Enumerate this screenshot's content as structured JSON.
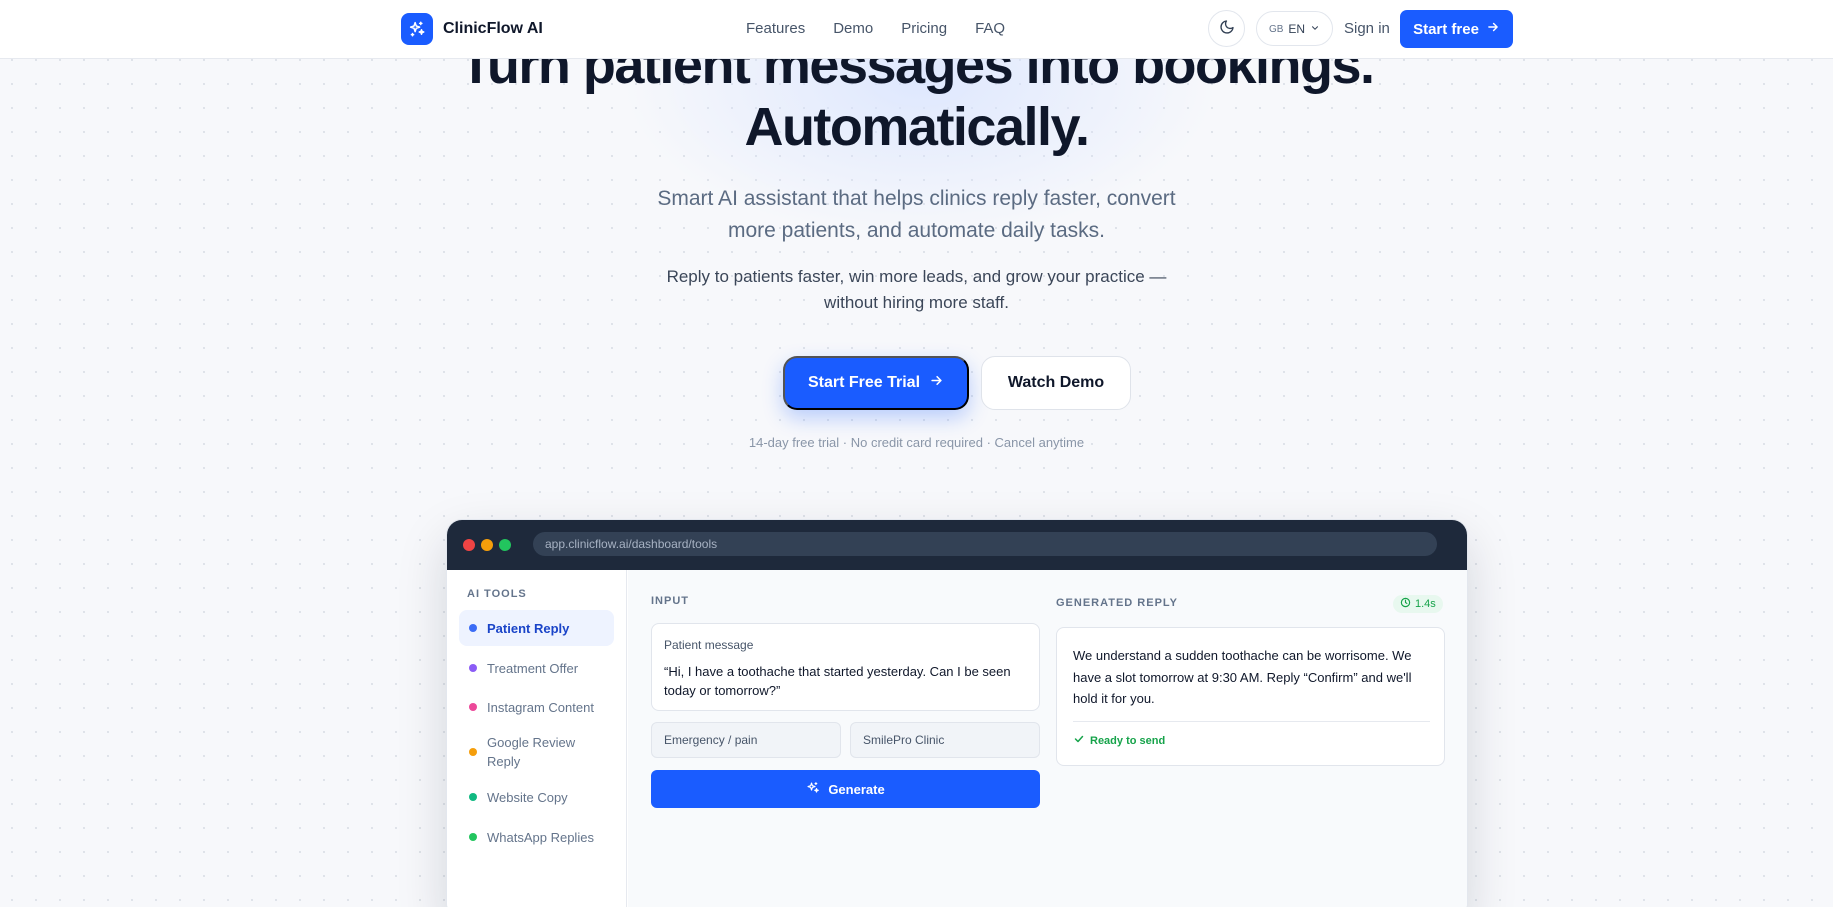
{
  "header": {
    "brand": "ClinicFlow AI",
    "nav": [
      "Features",
      "Demo",
      "Pricing",
      "FAQ"
    ],
    "lang_flag": "GB",
    "lang_code": "EN",
    "sign_in": "Sign in",
    "start_free": "Start free"
  },
  "hero": {
    "title_line1": "Turn patient messages into bookings.",
    "title_line2": "Automatically.",
    "subtitle": "Smart AI assistant that helps clinics reply faster, convert more patients, and automate daily tasks.",
    "subtitle2": "Reply to patients faster, win more leads, and grow your practice — without hiring more staff.",
    "cta_primary": "Start Free Trial",
    "cta_secondary": "Watch Demo",
    "fineprint": "14-day free trial · No credit card required · Cancel anytime"
  },
  "app": {
    "url": "app.clinicflow.ai/dashboard/tools",
    "sidebar_heading": "AI TOOLS",
    "tools": [
      {
        "label": "Patient Reply",
        "color": "#3b6cf6",
        "active": true
      },
      {
        "label": "Treatment Offer",
        "color": "#8b5cf6",
        "active": false
      },
      {
        "label": "Instagram Content",
        "color": "#ec4899",
        "active": false
      },
      {
        "label": "Google Review Reply",
        "color": "#f59e0b",
        "active": false
      },
      {
        "label": "Website Copy",
        "color": "#10b981",
        "active": false
      },
      {
        "label": "WhatsApp Replies",
        "color": "#22c55e",
        "active": false
      }
    ],
    "input_label": "INPUT",
    "message_label": "Patient message",
    "message_text": "“Hi, I have a toothache that started yesterday. Can I be seen today or tomorrow?”",
    "field_category": "Emergency / pain",
    "field_clinic": "SmilePro Clinic",
    "generate": "Generate",
    "output_label": "GENERATED REPLY",
    "time": "1.4s",
    "reply_text": "We understand a sudden toothache can be worrisome. We have a slot tomorrow at 9:30 AM. Reply “Confirm” and we'll hold it for you.",
    "status": "Ready to send"
  },
  "colors": {
    "accent": "#1a5cff",
    "success": "#16a34a",
    "dark": "#0f172a",
    "window_bar": "#1e293b"
  },
  "icons": [
    "sparkles-icon",
    "moon-icon",
    "chevron-down-icon",
    "arrow-right-icon",
    "clock-icon",
    "check-icon"
  ]
}
